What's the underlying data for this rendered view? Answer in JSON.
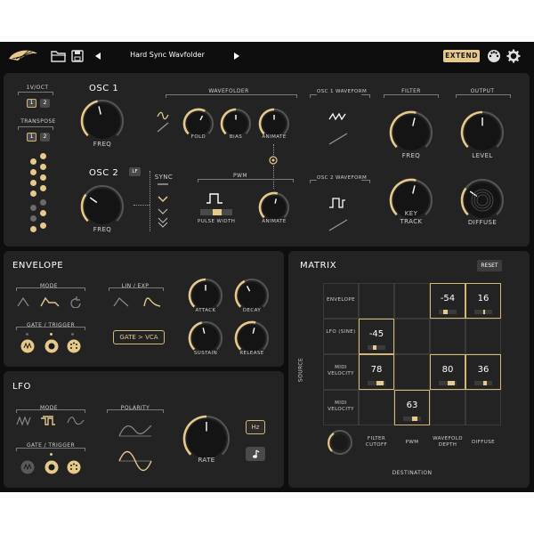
{
  "header": {
    "preset_name": "Hard Sync Wavfolder",
    "extend_label": "EXTEND",
    "icons": [
      "shell-logo-icon",
      "folder-icon",
      "save-icon",
      "prev-arrow-icon",
      "next-arrow-icon",
      "midi-icon",
      "gear-icon"
    ]
  },
  "osc": {
    "v_oct_label": "1V/OCT",
    "transpose_label": "TRANSPOSE",
    "v_oct_options": [
      "1",
      "2"
    ],
    "transpose_options": [
      "1",
      "2"
    ],
    "osc1_title": "OSC 1",
    "osc2_title": "OSC 2",
    "lf_label": "LF",
    "freq_label": "FREQ",
    "sync_label": "SYNC",
    "wavefolder_label": "WAVEFOLDER",
    "fold_label": "FOLD",
    "bias_label": "BIAS",
    "animate_label": "ANIMATE",
    "pwm_label": "PWM",
    "pulse_width_label": "PULSE WIDTH",
    "osc1_waveform_label": "OSC 1 WAVEFORM",
    "osc2_waveform_label": "OSC 2 WAVEFORM",
    "filter_label": "FILTER",
    "filter_freq_label": "FREQ",
    "key_track_label": "KEY TRACK",
    "output_label": "OUTPUT",
    "level_label": "LEVEL",
    "diffuse_label": "DIFFUSE",
    "knobs": {
      "osc1_freq": 0.45,
      "osc2_freq": 0.3,
      "fold": 0.6,
      "bias": 0.5,
      "animate1": 0.5,
      "animate2": 0.55,
      "filter_freq": 0.55,
      "key_track": 0.55,
      "level": 0.5,
      "diffuse": 0.3
    }
  },
  "envelope": {
    "title": "ENVELOPE",
    "mode_label": "MODE",
    "lin_exp_label": "LIN / EXP",
    "gate_trigger_label": "GATE / TRIGGER",
    "gate_vca_label": "GATE > VCA",
    "attack_label": "ATTACK",
    "decay_label": "DECAY",
    "sustain_label": "SUSTAIN",
    "release_label": "RELEASE",
    "knobs": {
      "attack": 0.5,
      "decay": 0.4,
      "sustain": 0.45,
      "release": 0.55
    }
  },
  "lfo": {
    "title": "LFO",
    "mode_label": "MODE",
    "polarity_label": "POLARITY",
    "gate_trigger_label": "GATE / TRIGGER",
    "rate_label": "RATE",
    "hz_label": "Hz",
    "knobs": {
      "rate": 0.5
    }
  },
  "matrix": {
    "title": "MATRIX",
    "reset_label": "RESET",
    "source_axis": "SOURCE",
    "destination_axis": "DESTINATION",
    "sources": [
      "ENVELOPE",
      "LFO (SINE)",
      "MIDI VELOCITY",
      "MIDI VELOCITY"
    ],
    "destinations": [
      "FILTER CUTOFF",
      "PWM",
      "WAVEFOLD DEPTH",
      "DIFFUSE"
    ],
    "cells": [
      {
        "row": 0,
        "col": 3,
        "value": "-54",
        "amount": -0.54
      },
      {
        "row": 0,
        "col": 4,
        "value": "16",
        "amount": 0.16
      },
      {
        "row": 1,
        "col": 1,
        "value": "-45",
        "amount": -0.45
      },
      {
        "row": 2,
        "col": 1,
        "value": "78",
        "amount": 0.78
      },
      {
        "row": 2,
        "col": 3,
        "value": "80",
        "amount": 0.8
      },
      {
        "row": 2,
        "col": 4,
        "value": "36",
        "amount": 0.36
      },
      {
        "row": 3,
        "col": 2,
        "value": "63",
        "amount": 0.63
      }
    ]
  },
  "colors": {
    "accent": "#e6c98b",
    "panel": "#232323",
    "background": "#0e0e0e"
  }
}
